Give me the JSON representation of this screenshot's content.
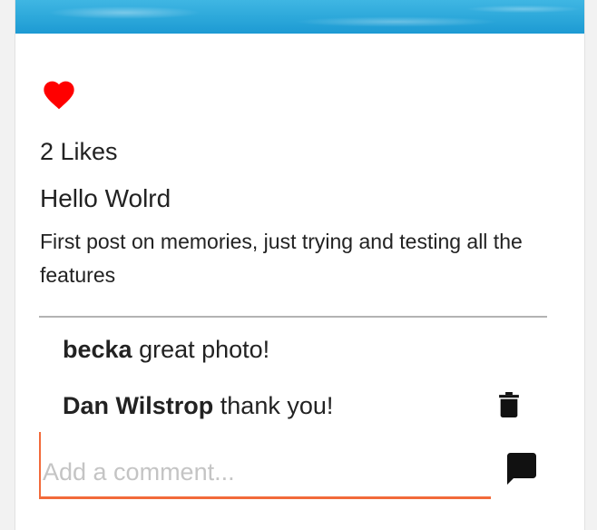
{
  "post": {
    "likes_text": "2 Likes",
    "title": "Hello Wolrd",
    "body": "First post on memories, just trying and testing all the features"
  },
  "comments": [
    {
      "author": "becka",
      "text": "great photo!"
    },
    {
      "author": "Dan Wilstrop",
      "text": "thank you!"
    }
  ],
  "comment_input": {
    "placeholder": "Add a comment...",
    "value": ""
  },
  "icons": {
    "like": "heart-icon",
    "delete": "trash-icon",
    "send": "comment-icon"
  },
  "colors": {
    "heart": "#ff0000",
    "input_underline": "#f26a3a",
    "text": "#222222",
    "placeholder": "#c4c4c4"
  }
}
